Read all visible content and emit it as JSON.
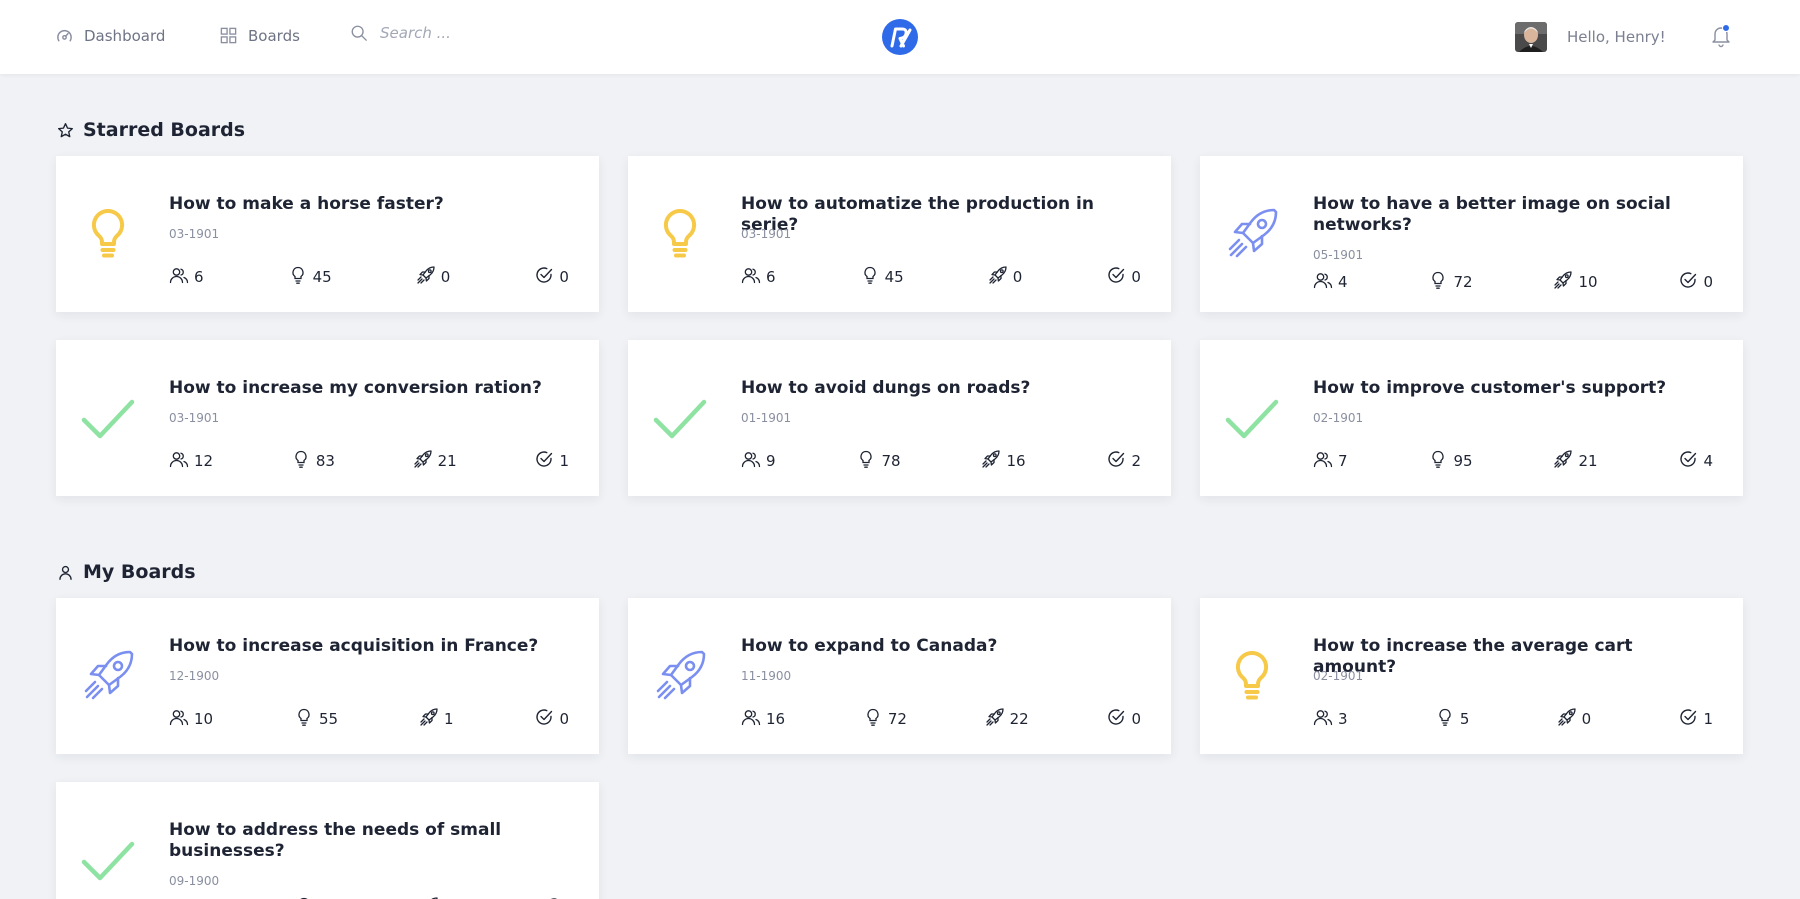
{
  "header": {
    "nav": {
      "dashboard": "Dashboard",
      "boards": "Boards"
    },
    "search_placeholder": "Search ...",
    "logo_icon": "rv-logo-icon",
    "greeting": "Hello, Henry!",
    "notification_badge_color": "#2f6be8"
  },
  "colors": {
    "accent": "#2f6be8",
    "bulb": "#f7c948",
    "rocket": "#7b8ff0",
    "check": "#8ee3a2",
    "text": "#1e2433",
    "muted": "#8a8fa0"
  },
  "sections": {
    "starred": {
      "title": "Starred Boards",
      "icon": "star-icon"
    },
    "mine": {
      "title": "My Boards",
      "icon": "user-icon"
    }
  },
  "starred_boards": [
    {
      "icon": "bulb",
      "title": "How to make a horse faster?",
      "date": "03-1901",
      "members": "6",
      "ideas": "45",
      "launched": "0",
      "done": "0"
    },
    {
      "icon": "bulb",
      "title": "How to automatize the production in serie?",
      "date": "03-1901",
      "members": "6",
      "ideas": "45",
      "launched": "0",
      "done": "0"
    },
    {
      "icon": "rocket",
      "title": "How to have a better image on social networks?",
      "date": "05-1901",
      "members": "4",
      "ideas": "72",
      "launched": "10",
      "done": "0"
    },
    {
      "icon": "check",
      "title": "How to increase my conversion ration?",
      "date": "03-1901",
      "members": "12",
      "ideas": "83",
      "launched": "21",
      "done": "1"
    },
    {
      "icon": "check",
      "title": "How to avoid dungs on roads?",
      "date": "01-1901",
      "members": "9",
      "ideas": "78",
      "launched": "16",
      "done": "2"
    },
    {
      "icon": "check",
      "title": "How to improve customer's support?",
      "date": "02-1901",
      "members": "7",
      "ideas": "95",
      "launched": "21",
      "done": "4"
    }
  ],
  "my_boards": [
    {
      "icon": "rocket",
      "title": "How to increase acquisition in France?",
      "date": "12-1900",
      "members": "10",
      "ideas": "55",
      "launched": "1",
      "done": "0"
    },
    {
      "icon": "rocket",
      "title": "How to expand to Canada?",
      "date": "11-1900",
      "members": "16",
      "ideas": "72",
      "launched": "22",
      "done": "0"
    },
    {
      "icon": "bulb",
      "title": "How to increase the average cart amount?",
      "date": "02-1901",
      "members": "3",
      "ideas": "5",
      "launched": "0",
      "done": "1"
    },
    {
      "icon": "check",
      "title": "How to address the needs of small businesses?",
      "date": "09-1900",
      "members": "",
      "ideas": "",
      "launched": "",
      "done": ""
    }
  ]
}
